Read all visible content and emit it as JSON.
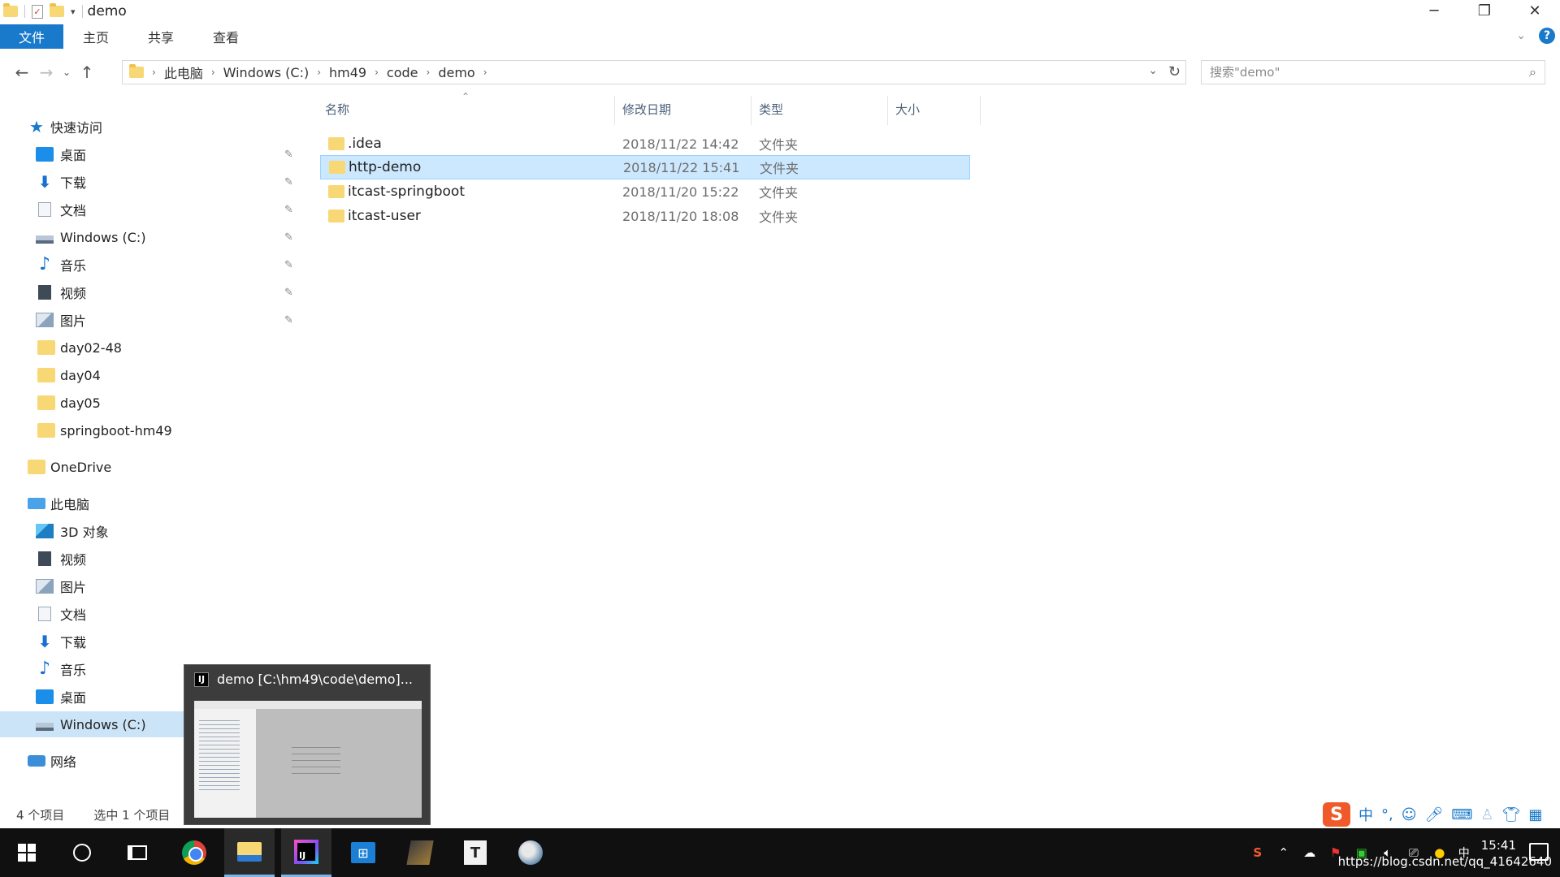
{
  "window": {
    "title": "demo",
    "min": "─",
    "max": "❐",
    "close": "✕"
  },
  "ribbon": {
    "tabs": [
      "文件",
      "主页",
      "共享",
      "查看"
    ]
  },
  "address": {
    "crumbs": [
      "此电脑",
      "Windows (C:)",
      "hm49",
      "code",
      "demo"
    ]
  },
  "search": {
    "placeholder": "搜索\"demo\""
  },
  "columns": {
    "name": "名称",
    "date": "修改日期",
    "type": "类型",
    "size": "大小"
  },
  "files": [
    {
      "name": ".idea",
      "date": "2018/11/22 14:42",
      "type": "文件夹"
    },
    {
      "name": "http-demo",
      "date": "2018/11/22 15:41",
      "type": "文件夹"
    },
    {
      "name": "itcast-springboot",
      "date": "2018/11/20 15:22",
      "type": "文件夹"
    },
    {
      "name": "itcast-user",
      "date": "2018/11/20 18:08",
      "type": "文件夹"
    }
  ],
  "nav": {
    "quick_access": "快速访问",
    "quick_items": [
      "桌面",
      "下载",
      "文档",
      "Windows (C:)",
      "音乐",
      "视频",
      "图片",
      "day02-48",
      "day04",
      "day05",
      "springboot-hm49"
    ],
    "onedrive": "OneDrive",
    "this_pc": "此电脑",
    "pc_items": [
      "3D 对象",
      "视频",
      "图片",
      "文档",
      "下载",
      "音乐",
      "桌面",
      "Windows (C:)"
    ],
    "network": "网络"
  },
  "status": {
    "count": "4 个项目",
    "selected": "选中 1 个项目"
  },
  "thumbnail": {
    "title": "demo [C:\\hm49\\code\\demo]..."
  },
  "ime": {
    "mode": "中"
  },
  "tray": {
    "lang": "中",
    "time": "15:41"
  },
  "watermark": "https://blog.csdn.net/qq_41642640"
}
